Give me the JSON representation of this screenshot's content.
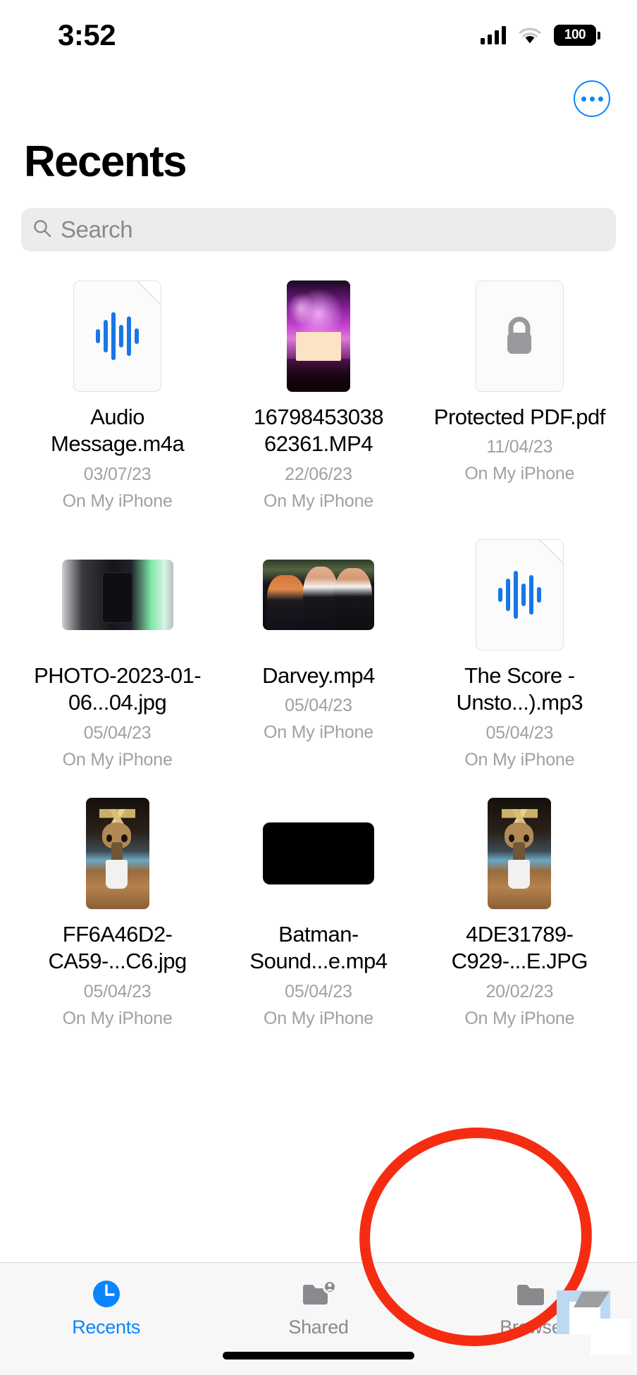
{
  "status_bar": {
    "time": "3:52",
    "cellular_icon": "cellular-bars-icon",
    "wifi_icon": "wifi-icon",
    "battery_level": "100",
    "battery_icon": "battery-full-icon"
  },
  "nav": {
    "more_button_label": "",
    "more_icon": "ellipsis-circle-icon"
  },
  "header": {
    "title": "Recents"
  },
  "search": {
    "placeholder": "Search",
    "value": "",
    "icon": "magnifying-glass-icon"
  },
  "files": [
    {
      "name": "Audio Message.m4a",
      "date": "03/07/23",
      "location": "On My iPhone",
      "thumb_kind": "audio-doc",
      "icon": "audio-waveform-icon"
    },
    {
      "name": "16798453038 62361.MP4",
      "date": "22/06/23",
      "location": "On My iPhone",
      "thumb_kind": "photo-concert",
      "icon": "video-thumbnail"
    },
    {
      "name": "Protected PDF.pdf",
      "date": "11/04/23",
      "location": "On My iPhone",
      "thumb_kind": "locked-doc",
      "icon": "lock-icon"
    },
    {
      "name": "PHOTO-2023-01-06...04.jpg",
      "date": "05/04/23",
      "location": "On My iPhone",
      "thumb_kind": "photo-laptop",
      "icon": "image-thumbnail"
    },
    {
      "name": "Darvey.mp4",
      "date": "05/04/23",
      "location": "On My iPhone",
      "thumb_kind": "photo-people",
      "icon": "video-thumbnail"
    },
    {
      "name": "The Score - Unsto...).mp3",
      "date": "05/04/23",
      "location": "On My iPhone",
      "thumb_kind": "audio-doc",
      "icon": "audio-waveform-icon"
    },
    {
      "name": "FF6A46D2-CA59-...C6.jpg",
      "date": "05/04/23",
      "location": "On My iPhone",
      "thumb_kind": "photo-groot",
      "icon": "image-thumbnail"
    },
    {
      "name": "Batman-Sound...e.mp4",
      "date": "05/04/23",
      "location": "On My iPhone",
      "thumb_kind": "video-black",
      "icon": "video-thumbnail"
    },
    {
      "name": "4DE31789-C929-...E.JPG",
      "date": "20/02/23",
      "location": "On My iPhone",
      "thumb_kind": "photo-groot",
      "icon": "image-thumbnail"
    }
  ],
  "tab_bar": {
    "tabs": [
      {
        "label": "Recents",
        "icon": "clock-icon",
        "active": true
      },
      {
        "label": "Shared",
        "icon": "folder-person-icon",
        "active": false
      },
      {
        "label": "Browse",
        "icon": "folder-icon",
        "active": false
      }
    ]
  },
  "annotation": {
    "shape": "ellipse-highlight",
    "color": "#f42d12",
    "target": "Browse"
  },
  "colors": {
    "accent": "#0a84ff",
    "annotation": "#f42d12",
    "secondary_text": "#a0a0a5",
    "search_bg": "#ececed",
    "tab_bar_bg": "#f7f7f7"
  }
}
